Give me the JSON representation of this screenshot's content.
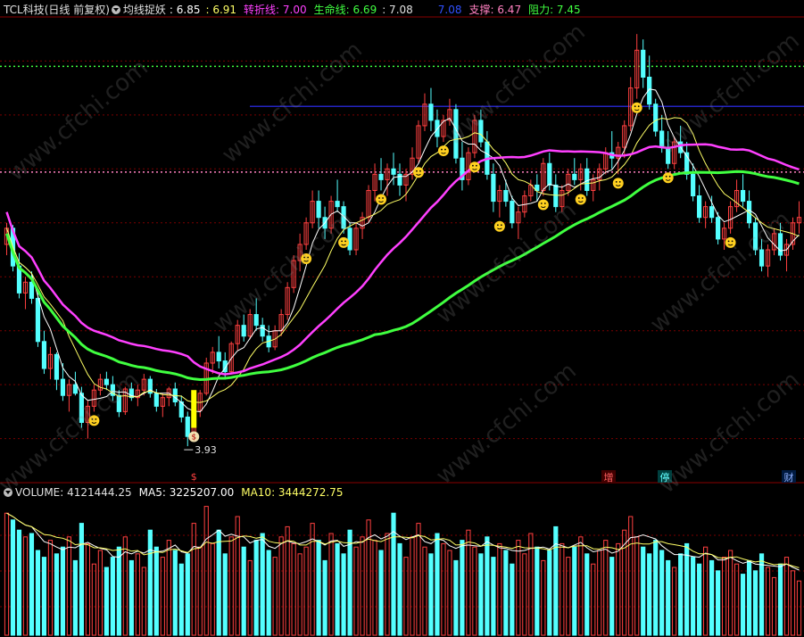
{
  "header": {
    "stock": "TCL科技(日线 前复权)",
    "indicator": "均线捉妖",
    "v1": ": 6.85",
    "v2": ": 6.91",
    "turn_label": "转折线: 7.00",
    "life_label": "生命线: 6.69",
    "v3": ": 7.08",
    "v4": "7.08",
    "support_label": "支撑: 6.47",
    "resist_label": "阻力: 7.45"
  },
  "volume_header": {
    "volume_label": "VOLUME: 4121444.25",
    "ma5_label": "MA5: 3225207.00",
    "ma10_label": "MA10: 3444272.75"
  },
  "annotations": {
    "low_price": "3.93",
    "buy_marker": "$",
    "tags": [
      "增",
      "停",
      "财"
    ]
  },
  "watermark": "www.cfchi.com",
  "colors": {
    "up": "#ff4040",
    "down": "#54ffff",
    "ma_fast": "#ffffff",
    "ma_slow": "#ffff66",
    "turn_line": "#ff40ff",
    "life_line": "#40ff40",
    "support": "#ff80c0",
    "resist": "#40ff40",
    "blue_line": "#3030ff",
    "grid": "#7a0000"
  },
  "chart_data": [
    {
      "type": "candlestick",
      "title": "TCL科技(日线 前复权)",
      "y_range": [
        3.6,
        7.9
      ],
      "levels": {
        "support": 6.47,
        "resistance": 7.45,
        "blue": 7.08,
        "low_marker": 3.93
      },
      "ohlc": [
        [
          5.8,
          6.0,
          5.7,
          5.95
        ],
        [
          5.95,
          5.98,
          5.55,
          5.6
        ],
        [
          5.6,
          5.72,
          5.3,
          5.35
        ],
        [
          5.35,
          5.5,
          5.2,
          5.45
        ],
        [
          5.45,
          5.55,
          5.25,
          5.3
        ],
        [
          5.3,
          5.35,
          4.85,
          4.9
        ],
        [
          4.9,
          5.0,
          4.6,
          4.65
        ],
        [
          4.65,
          4.85,
          4.55,
          4.78
        ],
        [
          4.78,
          4.8,
          4.45,
          4.55
        ],
        [
          4.55,
          4.7,
          4.35,
          4.4
        ],
        [
          4.4,
          4.55,
          4.25,
          4.5
        ],
        [
          4.5,
          4.62,
          4.4,
          4.42
        ],
        [
          4.42,
          4.48,
          4.1,
          4.15
        ],
        [
          4.15,
          4.35,
          4.0,
          4.3
        ],
        [
          4.3,
          4.5,
          4.25,
          4.45
        ],
        [
          4.45,
          4.6,
          4.4,
          4.55
        ],
        [
          4.55,
          4.62,
          4.45,
          4.5
        ],
        [
          4.5,
          4.58,
          4.35,
          4.4
        ],
        [
          4.4,
          4.45,
          4.2,
          4.25
        ],
        [
          4.25,
          4.48,
          4.22,
          4.46
        ],
        [
          4.46,
          4.52,
          4.35,
          4.38
        ],
        [
          4.38,
          4.5,
          4.3,
          4.45
        ],
        [
          4.45,
          4.6,
          4.4,
          4.55
        ],
        [
          4.55,
          4.58,
          4.38,
          4.42
        ],
        [
          4.42,
          4.46,
          4.25,
          4.3
        ],
        [
          4.3,
          4.42,
          4.2,
          4.38
        ],
        [
          4.38,
          4.48,
          4.3,
          4.46
        ],
        [
          4.46,
          4.52,
          4.3,
          4.34
        ],
        [
          4.34,
          4.4,
          4.15,
          4.2
        ],
        [
          4.2,
          4.25,
          3.93,
          4.02
        ],
        [
          4.02,
          4.3,
          4.0,
          4.26
        ],
        [
          4.26,
          4.45,
          4.2,
          4.42
        ],
        [
          4.42,
          4.75,
          4.4,
          4.7
        ],
        [
          4.7,
          4.85,
          4.6,
          4.8
        ],
        [
          4.8,
          4.95,
          4.65,
          4.72
        ],
        [
          4.72,
          4.8,
          4.55,
          4.62
        ],
        [
          4.62,
          4.9,
          4.6,
          4.88
        ],
        [
          4.88,
          5.1,
          4.82,
          5.05
        ],
        [
          5.05,
          5.15,
          4.9,
          4.95
        ],
        [
          4.95,
          5.2,
          4.92,
          5.15
        ],
        [
          5.15,
          5.3,
          5.0,
          5.05
        ],
        [
          5.05,
          5.12,
          4.9,
          4.95
        ],
        [
          4.95,
          5.05,
          4.8,
          4.85
        ],
        [
          4.85,
          5.05,
          4.82,
          5.0
        ],
        [
          5.0,
          5.2,
          4.95,
          5.15
        ],
        [
          5.15,
          5.45,
          5.1,
          5.4
        ],
        [
          5.4,
          5.7,
          5.35,
          5.65
        ],
        [
          5.65,
          5.9,
          5.55,
          5.8
        ],
        [
          5.8,
          6.05,
          5.75,
          6.0
        ],
        [
          6.0,
          6.3,
          5.95,
          6.2
        ],
        [
          6.2,
          6.3,
          5.95,
          6.05
        ],
        [
          6.05,
          6.15,
          5.85,
          5.95
        ],
        [
          5.95,
          6.25,
          5.9,
          6.2
        ],
        [
          6.2,
          6.4,
          6.1,
          6.15
        ],
        [
          6.15,
          6.2,
          5.9,
          5.95
        ],
        [
          5.95,
          6.0,
          5.7,
          5.75
        ],
        [
          5.75,
          6.0,
          5.7,
          5.95
        ],
        [
          5.95,
          6.1,
          5.85,
          6.05
        ],
        [
          6.05,
          6.35,
          6.0,
          6.3
        ],
        [
          6.3,
          6.55,
          6.2,
          6.45
        ],
        [
          6.45,
          6.6,
          6.3,
          6.4
        ],
        [
          6.4,
          6.55,
          6.25,
          6.5
        ],
        [
          6.5,
          6.65,
          6.35,
          6.45
        ],
        [
          6.45,
          6.55,
          6.25,
          6.35
        ],
        [
          6.35,
          6.5,
          6.2,
          6.45
        ],
        [
          6.45,
          6.7,
          6.4,
          6.6
        ],
        [
          6.6,
          6.95,
          6.55,
          6.9
        ],
        [
          6.9,
          7.2,
          6.85,
          7.1
        ],
        [
          7.1,
          7.25,
          6.85,
          6.95
        ],
        [
          6.95,
          7.05,
          6.7,
          6.8
        ],
        [
          6.8,
          7.0,
          6.75,
          6.95
        ],
        [
          6.95,
          7.15,
          6.9,
          7.05
        ],
        [
          7.05,
          7.1,
          6.55,
          6.6
        ],
        [
          6.6,
          6.75,
          6.3,
          6.4
        ],
        [
          6.4,
          6.7,
          6.35,
          6.65
        ],
        [
          6.65,
          7.0,
          6.6,
          6.95
        ],
        [
          6.95,
          7.05,
          6.7,
          6.75
        ],
        [
          6.75,
          6.85,
          6.4,
          6.45
        ],
        [
          6.45,
          6.55,
          6.1,
          6.2
        ],
        [
          6.2,
          6.35,
          6.05,
          6.3
        ],
        [
          6.3,
          6.4,
          6.15,
          6.2
        ],
        [
          6.2,
          6.25,
          5.95,
          6.0
        ],
        [
          6.0,
          6.15,
          5.85,
          6.1
        ],
        [
          6.1,
          6.3,
          6.05,
          6.25
        ],
        [
          6.25,
          6.4,
          6.2,
          6.35
        ],
        [
          6.35,
          6.45,
          6.2,
          6.3
        ],
        [
          6.3,
          6.6,
          6.25,
          6.55
        ],
        [
          6.55,
          6.65,
          6.3,
          6.35
        ],
        [
          6.35,
          6.45,
          6.1,
          6.15
        ],
        [
          6.15,
          6.35,
          6.1,
          6.3
        ],
        [
          6.3,
          6.5,
          6.25,
          6.45
        ],
        [
          6.45,
          6.6,
          6.35,
          6.4
        ],
        [
          6.4,
          6.55,
          6.3,
          6.5
        ],
        [
          6.5,
          6.6,
          6.25,
          6.3
        ],
        [
          6.3,
          6.45,
          6.2,
          6.4
        ],
        [
          6.4,
          6.55,
          6.3,
          6.5
        ],
        [
          6.5,
          6.7,
          6.45,
          6.65
        ],
        [
          6.65,
          6.85,
          6.5,
          6.6
        ],
        [
          6.6,
          6.75,
          6.45,
          6.7
        ],
        [
          6.7,
          6.95,
          6.6,
          6.9
        ],
        [
          6.9,
          7.35,
          6.85,
          7.25
        ],
        [
          7.25,
          7.75,
          7.15,
          7.6
        ],
        [
          7.6,
          7.7,
          7.25,
          7.35
        ],
        [
          7.35,
          7.55,
          7.05,
          7.1
        ],
        [
          7.1,
          7.15,
          6.8,
          6.85
        ],
        [
          6.85,
          7.0,
          6.65,
          6.7
        ],
        [
          6.7,
          6.85,
          6.5,
          6.55
        ],
        [
          6.55,
          6.8,
          6.5,
          6.75
        ],
        [
          6.75,
          6.9,
          6.6,
          6.65
        ],
        [
          6.65,
          6.75,
          6.4,
          6.45
        ],
        [
          6.45,
          6.55,
          6.2,
          6.25
        ],
        [
          6.25,
          6.35,
          6.0,
          6.05
        ],
        [
          6.05,
          6.2,
          5.95,
          6.15
        ],
        [
          6.15,
          6.25,
          6.0,
          6.05
        ],
        [
          6.05,
          6.1,
          5.8,
          5.85
        ],
        [
          5.85,
          6.0,
          5.75,
          5.95
        ],
        [
          5.95,
          6.2,
          5.9,
          6.15
        ],
        [
          6.15,
          6.4,
          6.1,
          6.3
        ],
        [
          6.3,
          6.45,
          6.15,
          6.2
        ],
        [
          6.2,
          6.3,
          5.95,
          6.0
        ],
        [
          6.0,
          6.05,
          5.7,
          5.75
        ],
        [
          5.75,
          5.85,
          5.55,
          5.6
        ],
        [
          5.6,
          5.8,
          5.5,
          5.75
        ],
        [
          5.75,
          5.95,
          5.7,
          5.9
        ],
        [
          5.9,
          6.0,
          5.65,
          5.7
        ],
        [
          5.7,
          5.85,
          5.55,
          5.8
        ],
        [
          5.8,
          6.05,
          5.75,
          6.0
        ],
        [
          6.0,
          6.2,
          5.9,
          6.05
        ]
      ],
      "series": [
        {
          "name": "转折线",
          "color": "#ff40ff"
        },
        {
          "name": "生命线",
          "color": "#40ff40"
        }
      ]
    },
    {
      "type": "bar",
      "title": "VOLUME",
      "values": [
        3.6,
        3.4,
        3.1,
        2.9,
        3.0,
        2.5,
        2.3,
        2.8,
        2.4,
        2.6,
        2.9,
        2.2,
        3.3,
        2.7,
        2.1,
        2.5,
        2.0,
        2.3,
        2.6,
        2.9,
        2.2,
        2.4,
        2.0,
        3.1,
        2.6,
        2.3,
        2.8,
        2.5,
        2.1,
        2.4,
        3.3,
        2.6,
        3.8,
        2.7,
        3.1,
        2.4,
        2.9,
        3.5,
        2.6,
        2.2,
        2.8,
        3.0,
        2.5,
        2.3,
        2.9,
        3.2,
        2.7,
        2.4,
        2.6,
        3.3,
        2.8,
        2.2,
        3.0,
        2.7,
        2.4,
        3.1,
        2.6,
        2.9,
        3.4,
        2.8,
        2.5,
        3.0,
        3.6,
        2.7,
        2.3,
        2.9,
        3.3,
        2.6,
        2.4,
        3.0,
        2.7,
        2.5,
        2.2,
        2.8,
        3.1,
        2.6,
        2.4,
        2.9,
        2.3,
        2.7,
        2.5,
        2.1,
        2.8,
        2.4,
        3.0,
        2.6,
        2.2,
        2.5,
        3.2,
        2.7,
        2.3,
        2.6,
        2.9,
        2.4,
        2.1,
        2.5,
        2.8,
        2.3,
        2.7,
        3.1,
        3.5,
        2.9,
        2.6,
        2.4,
        2.8,
        2.5,
        2.2,
        2.0,
        2.4,
        2.7,
        2.3,
        2.1,
        2.6,
        2.2,
        1.9,
        2.3,
        2.5,
        2.1,
        1.8,
        2.2,
        1.9,
        2.4,
        2.0,
        1.7,
        2.1,
        2.3,
        1.9,
        1.6
      ]
    }
  ]
}
